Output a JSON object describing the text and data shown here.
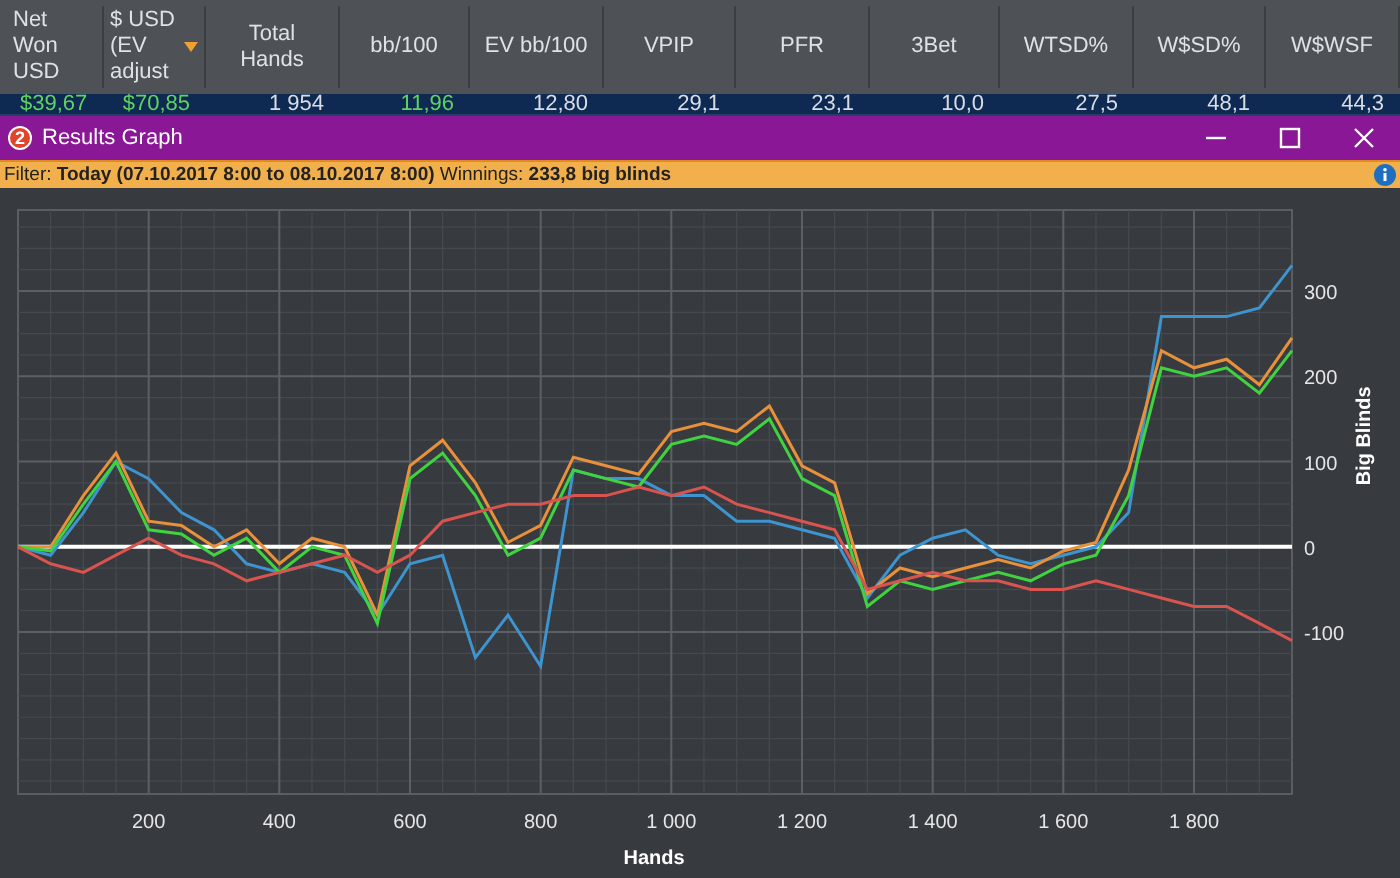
{
  "stats_table": {
    "columns": [
      {
        "label": "Net Won USD",
        "sorted": false
      },
      {
        "label": "$ USD (EV adjust",
        "sorted": true
      },
      {
        "label": "Total Hands",
        "sorted": false
      },
      {
        "label": "bb/100",
        "sorted": false
      },
      {
        "label": "EV bb/100",
        "sorted": false
      },
      {
        "label": "VPIP",
        "sorted": false
      },
      {
        "label": "PFR",
        "sorted": false
      },
      {
        "label": "3Bet",
        "sorted": false
      },
      {
        "label": "WTSD%",
        "sorted": false
      },
      {
        "label": "W$SD%",
        "sorted": false
      },
      {
        "label": "W$WSF",
        "sorted": false
      }
    ],
    "row": [
      {
        "value": "$39,67",
        "color": "#5fd35f"
      },
      {
        "value": "$70,85",
        "color": "#5fd35f"
      },
      {
        "value": "1 954",
        "color": "#d8dde4"
      },
      {
        "value": "11,96",
        "color": "#5fd35f"
      },
      {
        "value": "12,80",
        "color": "#d8dde4"
      },
      {
        "value": "29,1",
        "color": "#d8dde4"
      },
      {
        "value": "23,1",
        "color": "#d8dde4"
      },
      {
        "value": "10,0",
        "color": "#d8dde4"
      },
      {
        "value": "27,5",
        "color": "#d8dde4"
      },
      {
        "value": "48,1",
        "color": "#d8dde4"
      },
      {
        "value": "44,3",
        "color": "#d8dde4"
      }
    ]
  },
  "window": {
    "badge": "2",
    "title": "Results Graph"
  },
  "filter_bar": {
    "text": "Filter: **Today (07.10.2017 8:00 to 08.10.2017 8:00)** Winnings: **233,8 big blinds**"
  },
  "graph": {
    "chart_data": {
      "type": "line",
      "grid": true,
      "xlabel": "Hands",
      "ylabel": "Big Blinds",
      "xlim": [
        0,
        1950
      ],
      "ylim": [
        -290,
        395
      ],
      "xticks": [
        {
          "value": 200,
          "label": "200"
        },
        {
          "value": 400,
          "label": "400"
        },
        {
          "value": 600,
          "label": "600"
        },
        {
          "value": 800,
          "label": "800"
        },
        {
          "value": 1000,
          "label": "1 000"
        },
        {
          "value": 1200,
          "label": "1 200"
        },
        {
          "value": 1400,
          "label": "1 400"
        },
        {
          "value": 1600,
          "label": "1 600"
        },
        {
          "value": 1800,
          "label": "1 800"
        }
      ],
      "yticks": [
        {
          "value": -100,
          "label": "-100"
        },
        {
          "value": 0,
          "label": "0"
        },
        {
          "value": 100,
          "label": "100"
        },
        {
          "value": 200,
          "label": "200"
        },
        {
          "value": 300,
          "label": "300"
        }
      ],
      "x": [
        0,
        50,
        100,
        150,
        200,
        250,
        300,
        350,
        400,
        450,
        500,
        550,
        600,
        650,
        700,
        750,
        800,
        850,
        900,
        950,
        1000,
        1050,
        1100,
        1150,
        1200,
        1250,
        1300,
        1350,
        1400,
        1450,
        1500,
        1550,
        1600,
        1650,
        1700,
        1750,
        1800,
        1850,
        1900,
        1950
      ],
      "series": [
        {
          "color": "#3d94cf",
          "values": [
            0,
            -10,
            40,
            100,
            80,
            40,
            20,
            -20,
            -30,
            -20,
            -30,
            -80,
            -20,
            -10,
            -130,
            -80,
            -140,
            90,
            80,
            80,
            60,
            60,
            30,
            30,
            20,
            10,
            -60,
            -10,
            10,
            20,
            -10,
            -20,
            -10,
            0,
            40,
            270,
            270,
            270,
            280,
            330
          ]
        },
        {
          "color": "#e8903a",
          "values": [
            0,
            0,
            60,
            110,
            30,
            25,
            0,
            20,
            -20,
            10,
            0,
            -80,
            95,
            125,
            75,
            5,
            25,
            105,
            95,
            85,
            135,
            145,
            135,
            165,
            95,
            75,
            -55,
            -25,
            -35,
            -25,
            -15,
            -25,
            -5,
            5,
            90,
            230,
            210,
            220,
            190,
            245
          ]
        },
        {
          "color": "#3fd33f",
          "values": [
            0,
            -5,
            50,
            100,
            20,
            15,
            -10,
            10,
            -30,
            0,
            -10,
            -90,
            80,
            110,
            60,
            -10,
            10,
            90,
            80,
            70,
            120,
            130,
            120,
            150,
            80,
            60,
            -70,
            -40,
            -50,
            -40,
            -30,
            -40,
            -20,
            -10,
            60,
            210,
            200,
            210,
            180,
            230
          ]
        },
        {
          "color": "#d9534f",
          "values": [
            0,
            -20,
            -30,
            -10,
            10,
            -10,
            -20,
            -40,
            -30,
            -20,
            -10,
            -30,
            -10,
            30,
            40,
            50,
            50,
            60,
            60,
            70,
            60,
            70,
            50,
            40,
            30,
            20,
            -50,
            -40,
            -30,
            -40,
            -40,
            -50,
            -50,
            -40,
            -50,
            -60,
            -70,
            -70,
            -90,
            -110
          ]
        }
      ]
    }
  }
}
